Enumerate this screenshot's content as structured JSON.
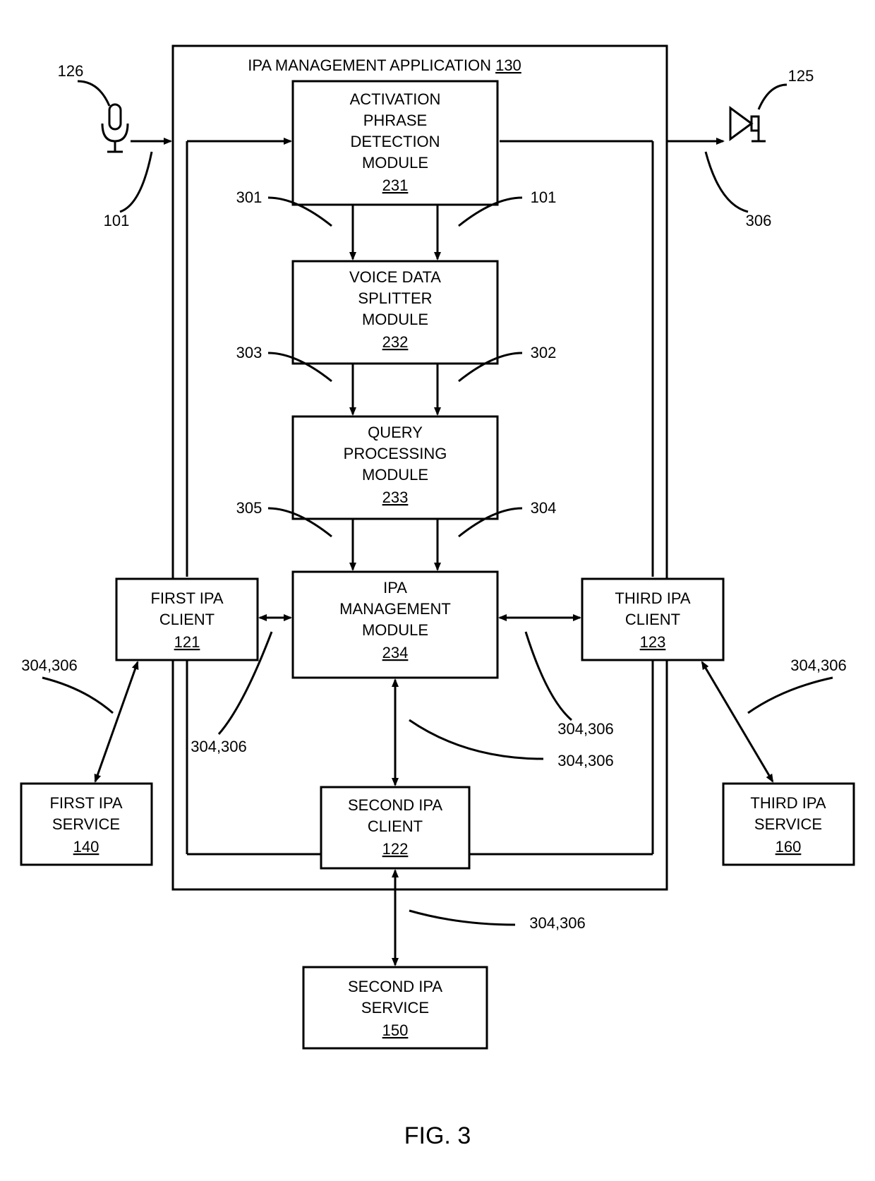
{
  "caption": "FIG. 3",
  "appTitle": "IPA MANAGEMENT APPLICATION",
  "appRef": "130",
  "modules": {
    "activation": {
      "l1": "ACTIVATION",
      "l2": "PHRASE",
      "l3": "DETECTION",
      "l4": "MODULE",
      "ref": "231"
    },
    "splitter": {
      "l1": "VOICE DATA",
      "l2": "SPLITTER",
      "l3": "MODULE",
      "ref": "232"
    },
    "query": {
      "l1": "QUERY",
      "l2": "PROCESSING",
      "l3": "MODULE",
      "ref": "233"
    },
    "mgmt": {
      "l1": "IPA",
      "l2": "MANAGEMENT",
      "l3": "MODULE",
      "ref": "234"
    }
  },
  "clients": {
    "first": {
      "l1": "FIRST IPA",
      "l2": "CLIENT",
      "ref": "121"
    },
    "second": {
      "l1": "SECOND IPA",
      "l2": "CLIENT",
      "ref": "122"
    },
    "third": {
      "l1": "THIRD IPA",
      "l2": "CLIENT",
      "ref": "123"
    }
  },
  "services": {
    "first": {
      "l1": "FIRST IPA",
      "l2": "SERVICE",
      "ref": "140"
    },
    "second": {
      "l1": "SECOND IPA",
      "l2": "SERVICE",
      "ref": "150"
    },
    "third": {
      "l1": "THIRD IPA",
      "l2": "SERVICE",
      "ref": "160"
    }
  },
  "labels": {
    "mic": "126",
    "speaker": "125",
    "micIn": "101",
    "speakerIn": "306",
    "l301": "301",
    "l101": "101",
    "l303": "303",
    "l302": "302",
    "l305": "305",
    "l304": "304",
    "pair": "304,306"
  }
}
